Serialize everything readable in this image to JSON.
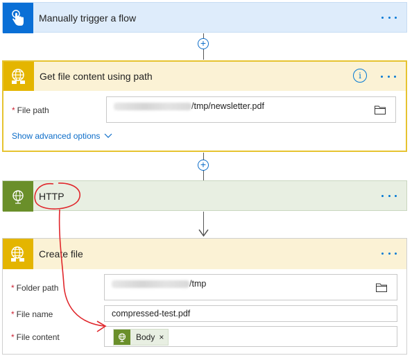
{
  "trigger": {
    "title": "Manually trigger a flow",
    "icon": "touch-icon",
    "accent": "#0a6fd6"
  },
  "get_file": {
    "title": "Get file content using path",
    "icon": "sftp-globe-icon",
    "accent": "#e4b500",
    "file_path_label": "File path",
    "file_path_value": "/tmp/newsletter.pdf",
    "advanced_label": "Show advanced options"
  },
  "http": {
    "title": "HTTP",
    "icon": "globe-icon",
    "accent": "#6a8f2a"
  },
  "create_file": {
    "title": "Create file",
    "icon": "sftp-globe-icon",
    "folder_path_label": "Folder path",
    "folder_path_value": "/tmp",
    "file_name_label": "File name",
    "file_name_value": "compressed-test.pdf",
    "file_content_label": "File content",
    "token_label": "Body",
    "token_remove": "×"
  },
  "required_marker": "*",
  "annotation_color": "#e0262b"
}
